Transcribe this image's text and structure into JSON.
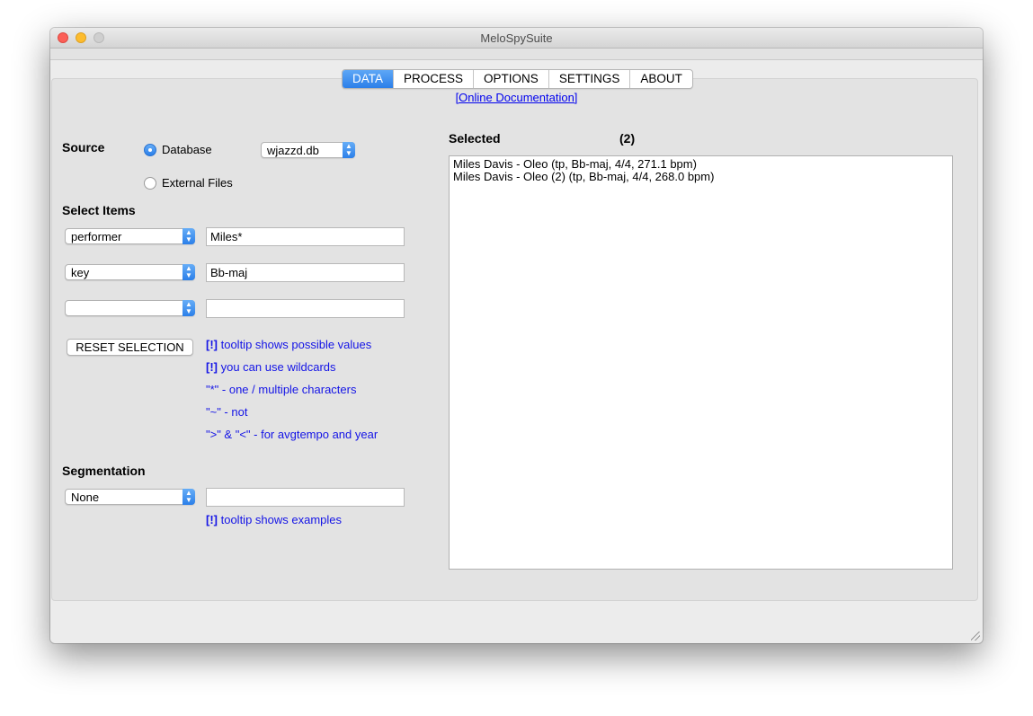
{
  "window": {
    "title": "MeloSpySuite"
  },
  "tabs": [
    {
      "label": "DATA",
      "active": true
    },
    {
      "label": "PROCESS",
      "active": false
    },
    {
      "label": "OPTIONS",
      "active": false
    },
    {
      "label": "SETTINGS",
      "active": false
    },
    {
      "label": "ABOUT",
      "active": false
    }
  ],
  "doc_link": "[Online Documentation]",
  "source": {
    "label": "Source",
    "database_label": "Database",
    "database_selected": true,
    "database_file": "wjazzd.db",
    "external_label": "External Files"
  },
  "select_items": {
    "label": "Select Items",
    "rows": [
      {
        "field": "performer",
        "value": "Miles*"
      },
      {
        "field": "key",
        "value": "Bb-maj"
      },
      {
        "field": "",
        "value": ""
      }
    ],
    "reset_label": "RESET SELECTION",
    "hints": {
      "h1_mark": "[!]",
      "h1_text": " tooltip shows possible values",
      "h2_mark": "[!]",
      "h2_text": " you can use wildcards",
      "h3": "\"*\" - one / multiple characters",
      "h4": "\"~\" - not",
      "h5": "\">\" & \"<\" - for avgtempo and year"
    }
  },
  "segmentation": {
    "label": "Segmentation",
    "selected": "None",
    "value": "",
    "hint_mark": "[!]",
    "hint_text": " tooltip shows examples"
  },
  "selected": {
    "label": "Selected",
    "count": "(2)",
    "items": [
      "Miles Davis - Oleo (tp, Bb-maj, 4/4, 271.1 bpm)",
      "Miles Davis - Oleo (2) (tp, Bb-maj, 4/4, 268.0 bpm)"
    ]
  },
  "colors": {
    "accent": "#2b7fe9",
    "hint": "#1414e6",
    "link": "#0000ee"
  }
}
